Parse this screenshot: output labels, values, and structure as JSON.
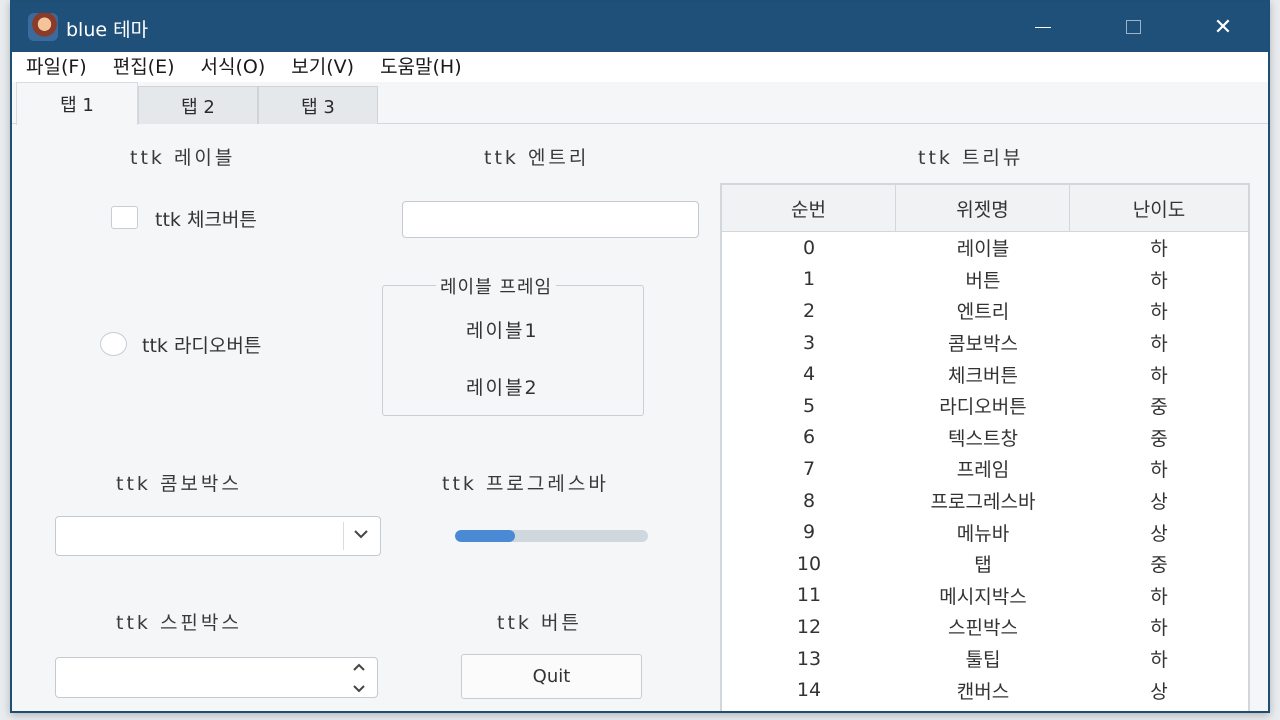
{
  "window": {
    "title": "blue 테마"
  },
  "menu": [
    "파일(F)",
    "편집(E)",
    "서식(O)",
    "보기(V)",
    "도움말(H)"
  ],
  "tabs": [
    "탭 1",
    "탭 2",
    "탭 3"
  ],
  "labels": {
    "label_title": "ttk 레이블",
    "entry_title": "ttk 엔트리",
    "treeview_title": "ttk 트리뷰",
    "checkbutton": "ttk 체크버튼",
    "radiobutton": "ttk 라디오버튼",
    "labelframe_title": "레이블 프레임",
    "labelframe_label1": "레이블1",
    "labelframe_label2": "레이블2",
    "combobox_title": "ttk 콤보박스",
    "progressbar_title": "ttk 프로그레스바",
    "spinbox_title": "ttk 스핀박스",
    "button_title": "ttk 버튼"
  },
  "entry": {
    "value": ""
  },
  "combobox": {
    "value": ""
  },
  "spinbox": {
    "value": ""
  },
  "progress": {
    "fraction": 0.31
  },
  "button": {
    "label": "Quit"
  },
  "tree": {
    "columns": [
      "순번",
      "위젯명",
      "난이도"
    ],
    "rows": [
      [
        "0",
        "레이블",
        "하"
      ],
      [
        "1",
        "버튼",
        "하"
      ],
      [
        "2",
        "엔트리",
        "하"
      ],
      [
        "3",
        "콤보박스",
        "하"
      ],
      [
        "4",
        "체크버튼",
        "하"
      ],
      [
        "5",
        "라디오버튼",
        "중"
      ],
      [
        "6",
        "텍스트창",
        "중"
      ],
      [
        "7",
        "프레임",
        "하"
      ],
      [
        "8",
        "프로그레스바",
        "상"
      ],
      [
        "9",
        "메뉴바",
        "상"
      ],
      [
        "10",
        "탭",
        "중"
      ],
      [
        "11",
        "메시지박스",
        "하"
      ],
      [
        "12",
        "스핀박스",
        "하"
      ],
      [
        "13",
        "툴팁",
        "하"
      ],
      [
        "14",
        "캔버스",
        "상"
      ]
    ]
  },
  "colors": {
    "titlebar": "#1f5079",
    "progress_fill": "#4a8ad4"
  }
}
